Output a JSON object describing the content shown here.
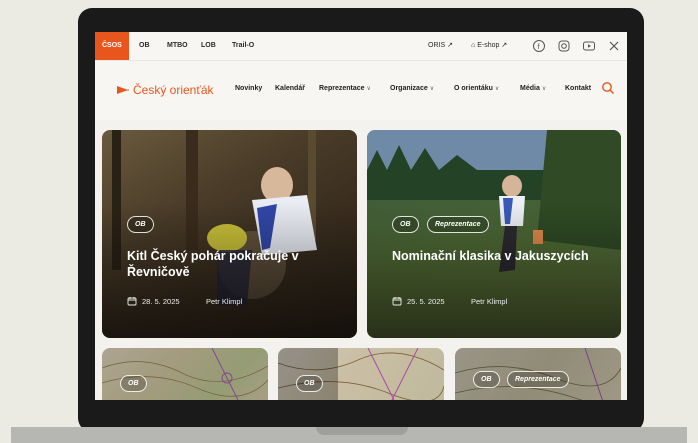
{
  "topbar": {
    "links": [
      "ČSOS",
      "OB",
      "MTBO",
      "LOB",
      "Trail-O"
    ],
    "external": [
      "ORIS",
      "E-shop"
    ],
    "social_icons": [
      "facebook-icon",
      "instagram-icon",
      "youtube-icon",
      "x-icon"
    ]
  },
  "header": {
    "logo_text": "Český orienťák",
    "nav": [
      "Novinky",
      "Kalendář",
      "Reprezentace",
      "Organizace",
      "O orientáku",
      "Média",
      "Kontakt"
    ]
  },
  "cards": [
    {
      "tags": [
        "OB"
      ],
      "title": "Kitl Český pohár pokračuje v Řevničově",
      "date": "28. 5. 2025",
      "author": "Petr Klimpl"
    },
    {
      "tags": [
        "OB",
        "Reprezentace"
      ],
      "title": "Nominační klasika v Jakuszycích",
      "date": "25. 5. 2025",
      "author": "Petr Klimpl"
    }
  ],
  "map_cards": [
    {
      "tags": [
        "OB"
      ]
    },
    {
      "tags": [
        "OB"
      ]
    },
    {
      "tags": [
        "OB",
        "Reprezentace"
      ]
    }
  ],
  "colors": {
    "accent": "#e8561e"
  }
}
